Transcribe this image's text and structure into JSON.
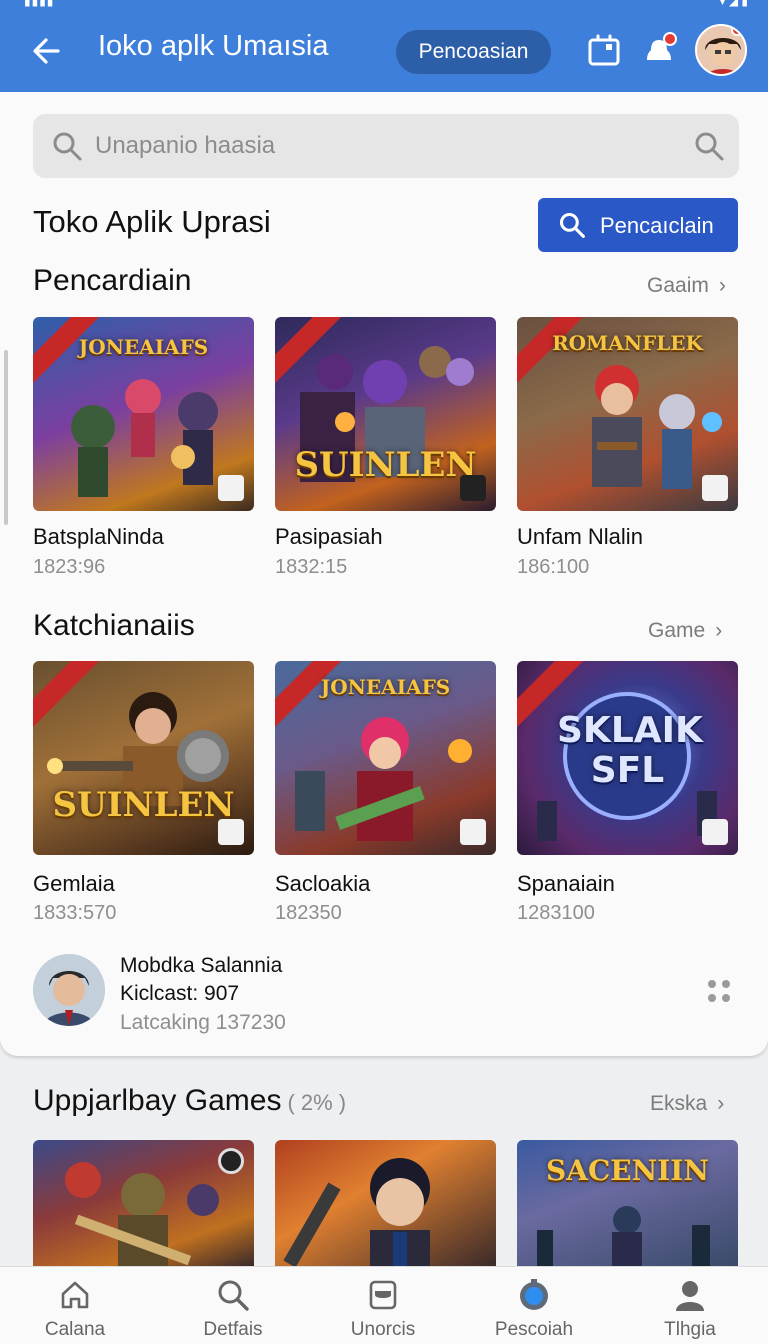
{
  "app": {
    "title": "Ioko aplk Umaısia",
    "pill_label": "Pencoasian"
  },
  "search": {
    "placeholder": "Unapanio haasia"
  },
  "page": {
    "heading": "Toko Aplik Uprasi",
    "cta_label": "Pencaıclain"
  },
  "sections": [
    {
      "title": "Pencardiain",
      "see_all": "Gaaim",
      "games": [
        {
          "name": "BatsplaNinda",
          "count": "1823:96",
          "logo": "JONEAIAFS"
        },
        {
          "name": "Pasipasiah",
          "count": "1832:15",
          "logo": "SUINLEN"
        },
        {
          "name": "Unfam Nlalin",
          "count": "186:100",
          "logo": "ROMANFLEK"
        }
      ]
    },
    {
      "title": "Katchianaiis",
      "see_all": "Game",
      "games": [
        {
          "name": "Gemlaia",
          "count": "1833:570",
          "logo": "SUINLEN"
        },
        {
          "name": "Sacloakia",
          "count": "182350",
          "logo": "JONEAIAFS"
        },
        {
          "name": "Spanaiain",
          "count": "1283100",
          "logo": "SKLAIK SFL"
        }
      ]
    }
  ],
  "user": {
    "name": "Mobdka Salannia",
    "line2": "Kiclcast: 907",
    "line3": "Latcaking 137230"
  },
  "lower": {
    "title": "Uppjarlbay Games",
    "count": "( 2% )",
    "see_all": "Ekska",
    "logo": "SACENIIN"
  },
  "bottom_nav": [
    {
      "label": "Calana",
      "icon": "home-icon"
    },
    {
      "label": "Detfais",
      "icon": "search-icon"
    },
    {
      "label": "Unorcis",
      "icon": "inbox-icon"
    },
    {
      "label": "Pescoiah",
      "icon": "radio-target-icon"
    },
    {
      "label": "Tlhgia",
      "icon": "person-icon"
    }
  ],
  "colors": {
    "appbar": "#3f7fdc",
    "cta": "#2b58c7",
    "badge": "#e53935"
  }
}
